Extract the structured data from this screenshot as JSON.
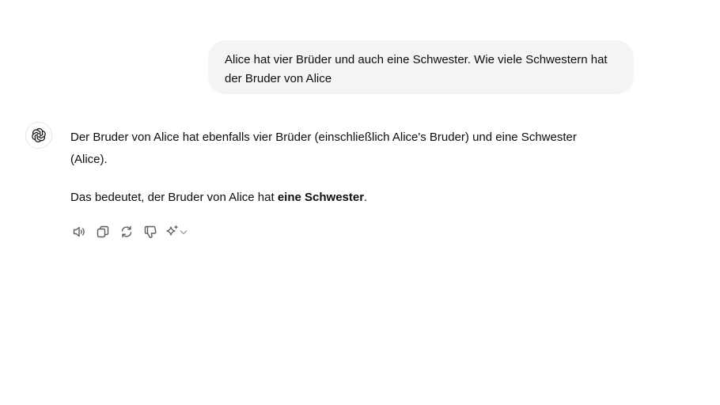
{
  "user_message": {
    "text": "Alice hat vier Brüder und auch eine Schwester. Wie viele Schwestern hat der Bruder von Alice"
  },
  "assistant": {
    "avatar_icon": "openai-logo-icon",
    "paragraph1": "Der Bruder von Alice hat ebenfalls vier Brüder (einschließlich Alice's Bruder) und eine Schwester (Alice).",
    "paragraph2_prefix": "Das bedeutet, der Bruder von Alice hat ",
    "paragraph2_bold": "eine Schwester",
    "paragraph2_suffix": "."
  },
  "actions": [
    {
      "name": "read-aloud",
      "icon": "speaker-icon"
    },
    {
      "name": "copy",
      "icon": "copy-icon"
    },
    {
      "name": "regenerate",
      "icon": "refresh-icon"
    },
    {
      "name": "bad-response",
      "icon": "thumbs-down-icon"
    },
    {
      "name": "change-model",
      "icon": "sparkle-icon"
    }
  ],
  "colors": {
    "user_bubble_bg": "#f4f4f4",
    "text": "#0d0d0d",
    "icon": "#5d5d5d"
  }
}
